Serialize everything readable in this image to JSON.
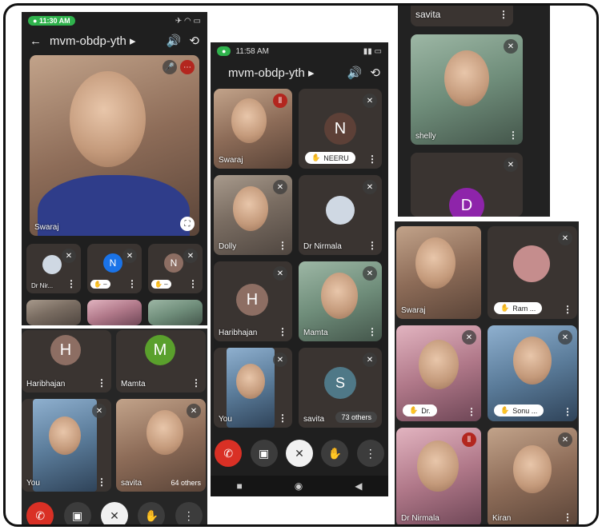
{
  "shot1": {
    "status_time": "11:30 AM",
    "status_icons": "✈ ◠ ▭",
    "meeting_code": "mvm-obdp-yth",
    "main_speaker": "Swaraj",
    "thumbs": [
      {
        "name": "Dr Nir...",
        "initial": "",
        "color": ""
      },
      {
        "name": "",
        "initial": "N",
        "color": "#1a73e8"
      },
      {
        "name": "",
        "initial": "N",
        "color": "#8d6e63"
      }
    ]
  },
  "shot4": {
    "tiles": [
      {
        "name": "Haribhajan",
        "initial": "H",
        "color": "#8d6e63"
      },
      {
        "name": "Mamta",
        "initial": "M",
        "color": "#5aa02c"
      },
      {
        "name": "You"
      },
      {
        "name": "savita",
        "others": "64 others"
      }
    ]
  },
  "shot2": {
    "status_time": "11:58 AM",
    "meeting_code": "mvm-obdp-yth",
    "tiles": [
      {
        "name": "Swaraj"
      },
      {
        "name": "NEERU",
        "initial": "N",
        "color": "#5d4037"
      },
      {
        "name": "Dolly"
      },
      {
        "name": "Dr Nirmala"
      },
      {
        "name": "Haribhajan",
        "initial": "H",
        "color": "#8d6e63"
      },
      {
        "name": "Mamta"
      },
      {
        "name": "You"
      },
      {
        "name": "savita",
        "initial": "S",
        "color": "#4f7887",
        "others": "73 others"
      }
    ]
  },
  "shot3": {
    "tiles": [
      {
        "name": "savita"
      },
      {
        "name": "shelly"
      },
      {
        "name": "",
        "initial": "D",
        "color": "#8e24aa"
      }
    ]
  },
  "shot5": {
    "tiles": [
      {
        "name": "Swaraj"
      },
      {
        "name": "Ram ..."
      },
      {
        "name": "Dr."
      },
      {
        "name": "Sonu ..."
      },
      {
        "name": "Dr Nirmala"
      },
      {
        "name": "Kiran"
      }
    ]
  },
  "icons": {
    "muted": "mic-off-icon",
    "speaking": "audio-wave-icon",
    "hand": "raise-hand-icon",
    "more": "more-vert-icon",
    "end": "call-end-icon",
    "camera": "videocam-icon",
    "speaker": "speaker-icon",
    "switch": "switch-camera-icon",
    "back": "arrow-back-icon"
  }
}
